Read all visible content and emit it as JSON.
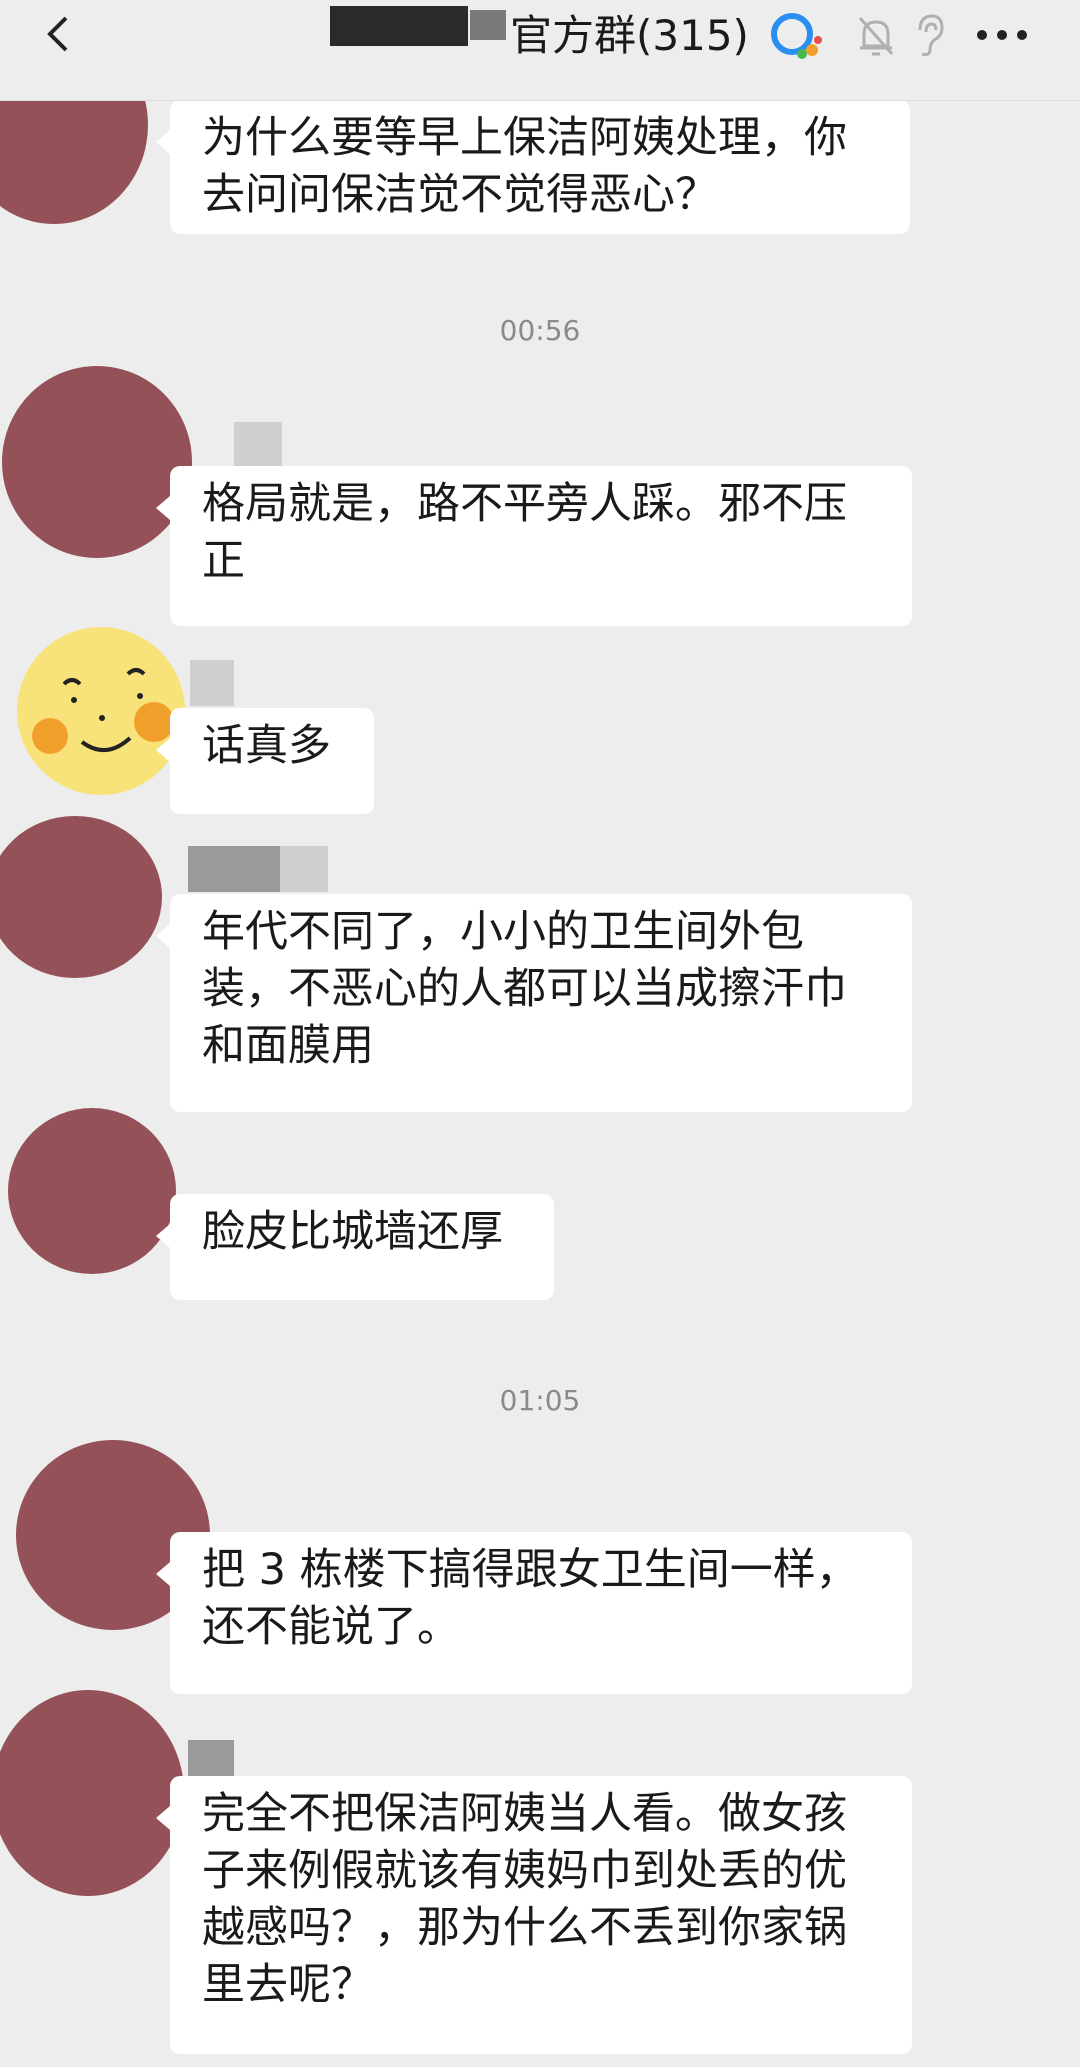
{
  "header": {
    "title": "官方群(315)",
    "icons": [
      "back-icon",
      "group-badge-icon",
      "mute-bell-icon",
      "ear-icon",
      "more-icon"
    ]
  },
  "colors": {
    "background": "#ededed",
    "bubble": "#ffffff",
    "avatar": "#955158",
    "smiley": "#f8e27a",
    "cheek": "#f0a02a"
  },
  "timestamps": [
    "00:56",
    "01:05"
  ],
  "messages": [
    {
      "avatar": "maroon-circle",
      "text": "为什么要等早上保洁阿姨处理，你去问问保洁觉不觉得恶心？"
    },
    {
      "avatar": "maroon-circle",
      "text": "格局就是，路不平旁人踩。邪不压正"
    },
    {
      "avatar": "smiley-face",
      "text": "话真多"
    },
    {
      "avatar": "maroon-circle",
      "text": "年代不同了，小小的卫生间外包装，不恶心的人都可以当成擦汗巾和面膜用"
    },
    {
      "avatar": "maroon-circle",
      "text": "脸皮比城墙还厚"
    },
    {
      "avatar": "maroon-circle",
      "text": "把 3 栋楼下搞得跟女卫生间一样，还不能说了。"
    },
    {
      "avatar": "maroon-circle",
      "text": "完全不把保洁阿姨当人看。做女孩子来例假就该有姨妈巾到处丢的优越感吗？，那为什么不丢到你家锅里去呢？"
    }
  ]
}
